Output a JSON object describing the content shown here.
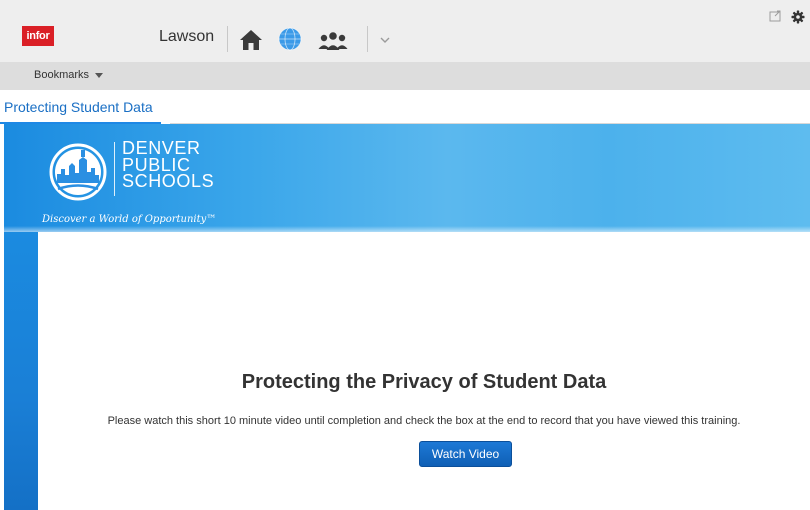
{
  "header": {
    "logo_text": "infor",
    "app_name": "Lawson",
    "icons": [
      "home-icon",
      "globe-icon",
      "people-icon",
      "chevron-down-icon",
      "window-icon",
      "gear-icon"
    ]
  },
  "bookmarks": {
    "label": "Bookmarks"
  },
  "tab": {
    "label": "Protecting Student Data"
  },
  "banner": {
    "line1": "DENVER",
    "line2": "PUBLIC",
    "line3": "SCHOOLS",
    "tagline": "Discover a World of Opportunity™"
  },
  "main": {
    "heading": "Protecting the Privacy of Student Data",
    "instructions": "Please watch this short 10 minute video until completion and check the box at the end to record that you have viewed this training.",
    "button_label": "Watch Video"
  },
  "colors": {
    "brand_red": "#da1f26",
    "tab_blue": "#1a6fc4",
    "banner_blue": "#3aa6ea",
    "button_blue": "#1466c0"
  }
}
